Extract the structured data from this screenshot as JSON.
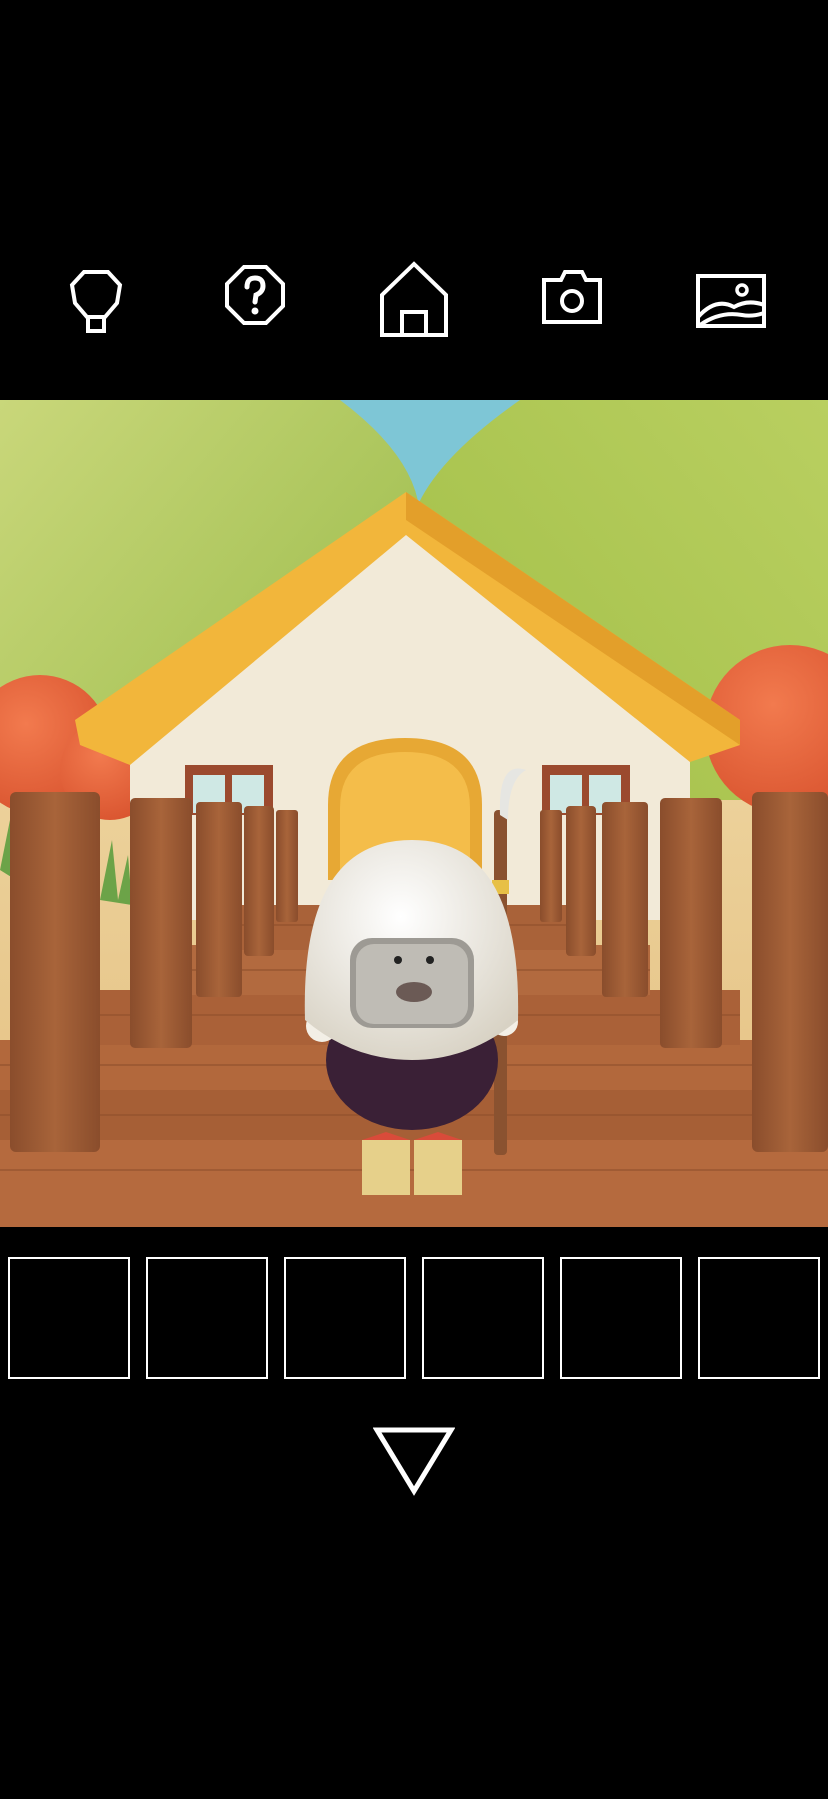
{
  "toolbar": {
    "buttons": [
      {
        "id": "hint",
        "icon": "lightbulb-icon"
      },
      {
        "id": "help",
        "icon": "question-icon"
      },
      {
        "id": "home",
        "icon": "house-icon"
      },
      {
        "id": "camera",
        "icon": "camera-icon"
      },
      {
        "id": "album",
        "icon": "image-icon"
      }
    ],
    "icon_color": "#ffffff"
  },
  "scene": {
    "description_colors": {
      "sky": "#7ec6d6",
      "hills": "#a9c452",
      "house_wall": "#f2ead8",
      "roof": "#f2b63b",
      "door": "#f1b13e",
      "posts": "#9b5a33",
      "deck": "#b2683c",
      "trees": "#e8633c"
    }
  },
  "inventory": {
    "slots": [
      {
        "item": null
      },
      {
        "item": null
      },
      {
        "item": null
      },
      {
        "item": null
      },
      {
        "item": null
      },
      {
        "item": null
      }
    ]
  },
  "navigation": {
    "down_icon": "triangle-down-icon"
  }
}
